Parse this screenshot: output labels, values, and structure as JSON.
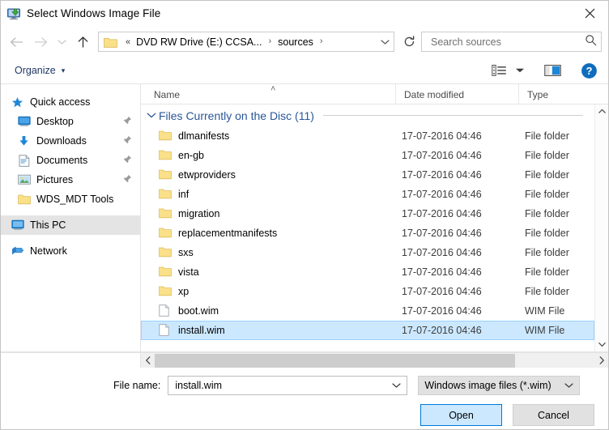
{
  "window": {
    "title": "Select Windows Image File",
    "icon": "deployment-image-icon",
    "close_label": "Close"
  },
  "nav": {
    "back": "Back",
    "forward": "Forward",
    "recent": "Recent locations",
    "up": "Up to This PC",
    "refresh": "Refresh",
    "breadcrumbs": [
      {
        "label": "DVD RW Drive (E:) CCSA...",
        "leading": "«"
      },
      {
        "label": "sources",
        "leading": ""
      }
    ],
    "address_dropdown": "Previous locations"
  },
  "search": {
    "placeholder": "Search sources",
    "value": "",
    "icon": "search-icon"
  },
  "toolbar": {
    "organize_label": "Organize",
    "organize_caret": "▾",
    "view_icon": "view-options-icon",
    "view_caret": "▾",
    "preview_icon": "preview-pane-icon",
    "help_icon": "help-icon",
    "help_glyph": "?"
  },
  "sidebar": {
    "items": [
      {
        "label": "Quick access",
        "icon": "star-icon",
        "level": "root",
        "pinned": false,
        "selected": false
      },
      {
        "label": "Desktop",
        "icon": "desktop-icon",
        "level": "child",
        "pinned": true,
        "selected": false
      },
      {
        "label": "Downloads",
        "icon": "downloads-icon",
        "level": "child",
        "pinned": true,
        "selected": false
      },
      {
        "label": "Documents",
        "icon": "documents-icon",
        "level": "child",
        "pinned": true,
        "selected": false
      },
      {
        "label": "Pictures",
        "icon": "pictures-icon",
        "level": "child",
        "pinned": true,
        "selected": false
      },
      {
        "label": "WDS_MDT Tools",
        "icon": "folder-icon",
        "level": "child",
        "pinned": false,
        "selected": false
      },
      {
        "label": "This PC",
        "icon": "this-pc-icon",
        "level": "root",
        "pinned": false,
        "selected": true
      },
      {
        "label": "Network",
        "icon": "network-icon",
        "level": "root",
        "pinned": false,
        "selected": false
      }
    ]
  },
  "filelist": {
    "columns": [
      {
        "label": "Name",
        "sorted": "ascending",
        "sort_glyph": "˄"
      },
      {
        "label": "Date modified",
        "sorted": "",
        "sort_glyph": ""
      },
      {
        "label": "Type",
        "sorted": "",
        "sort_glyph": ""
      }
    ],
    "group": {
      "label": "Files Currently on the Disc (11)",
      "expanded": true,
      "chevron": "⌄"
    },
    "rows": [
      {
        "name": "dlmanifests",
        "date": "17-07-2016 04:46",
        "type": "File folder",
        "icon": "folder-icon",
        "selected": false
      },
      {
        "name": "en-gb",
        "date": "17-07-2016 04:46",
        "type": "File folder",
        "icon": "folder-icon",
        "selected": false
      },
      {
        "name": "etwproviders",
        "date": "17-07-2016 04:46",
        "type": "File folder",
        "icon": "folder-icon",
        "selected": false
      },
      {
        "name": "inf",
        "date": "17-07-2016 04:46",
        "type": "File folder",
        "icon": "folder-icon",
        "selected": false
      },
      {
        "name": "migration",
        "date": "17-07-2016 04:46",
        "type": "File folder",
        "icon": "folder-icon",
        "selected": false
      },
      {
        "name": "replacementmanifests",
        "date": "17-07-2016 04:46",
        "type": "File folder",
        "icon": "folder-icon",
        "selected": false
      },
      {
        "name": "sxs",
        "date": "17-07-2016 04:46",
        "type": "File folder",
        "icon": "folder-icon",
        "selected": false
      },
      {
        "name": "vista",
        "date": "17-07-2016 04:46",
        "type": "File folder",
        "icon": "folder-icon",
        "selected": false
      },
      {
        "name": "xp",
        "date": "17-07-2016 04:46",
        "type": "File folder",
        "icon": "folder-icon",
        "selected": false
      },
      {
        "name": "boot.wim",
        "date": "17-07-2016 04:46",
        "type": "WIM File",
        "icon": "file-icon",
        "selected": false
      },
      {
        "name": "install.wim",
        "date": "17-07-2016 04:46",
        "type": "WIM File",
        "icon": "file-icon",
        "selected": true
      }
    ]
  },
  "footer": {
    "filename_label": "File name:",
    "filename_value": "install.wim",
    "filter_value": "Windows image files (*.wim)",
    "open_label": "Open",
    "cancel_label": "Cancel"
  },
  "colors": {
    "selection": "#cce8ff",
    "selection_border": "#99d1ff",
    "accent": "#0078d7",
    "group_header": "#2a5699",
    "organize_text": "#1f3864",
    "sidebar_selected": "#e4e4e4",
    "folder": "#fbe08a"
  }
}
